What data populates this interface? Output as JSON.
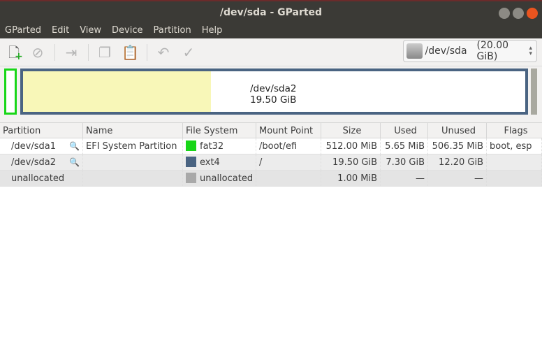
{
  "window": {
    "title": "/dev/sda - GParted"
  },
  "menu": [
    "GParted",
    "Edit",
    "View",
    "Device",
    "Partition",
    "Help"
  ],
  "device": {
    "name": "/dev/sda",
    "size": "(20.00 GiB)"
  },
  "disk_map": {
    "label": "/dev/sda2",
    "size": "19.50 GiB",
    "sda2_used_fraction": 0.374
  },
  "colors": {
    "fat32": "#18d618",
    "ext4": "#4a6482",
    "unallocated": "#a9a9a9"
  },
  "columns": [
    "Partition",
    "Name",
    "File System",
    "Mount Point",
    "Size",
    "Used",
    "Unused",
    "Flags"
  ],
  "rows": [
    {
      "partition": "/dev/sda1",
      "name": "EFI System Partition",
      "fs": "fat32",
      "mount": "/boot/efi",
      "size": "512.00 MiB",
      "used": "5.65 MiB",
      "unused": "506.35 MiB",
      "flags": "boot, esp"
    },
    {
      "partition": "/dev/sda2",
      "name": "",
      "fs": "ext4",
      "mount": "/",
      "size": "19.50 GiB",
      "used": "7.30 GiB",
      "unused": "12.20 GiB",
      "flags": ""
    },
    {
      "partition": "unallocated",
      "name": "",
      "fs": "unallocated",
      "mount": "",
      "size": "1.00 MiB",
      "used": "—",
      "unused": "—",
      "flags": ""
    }
  ]
}
